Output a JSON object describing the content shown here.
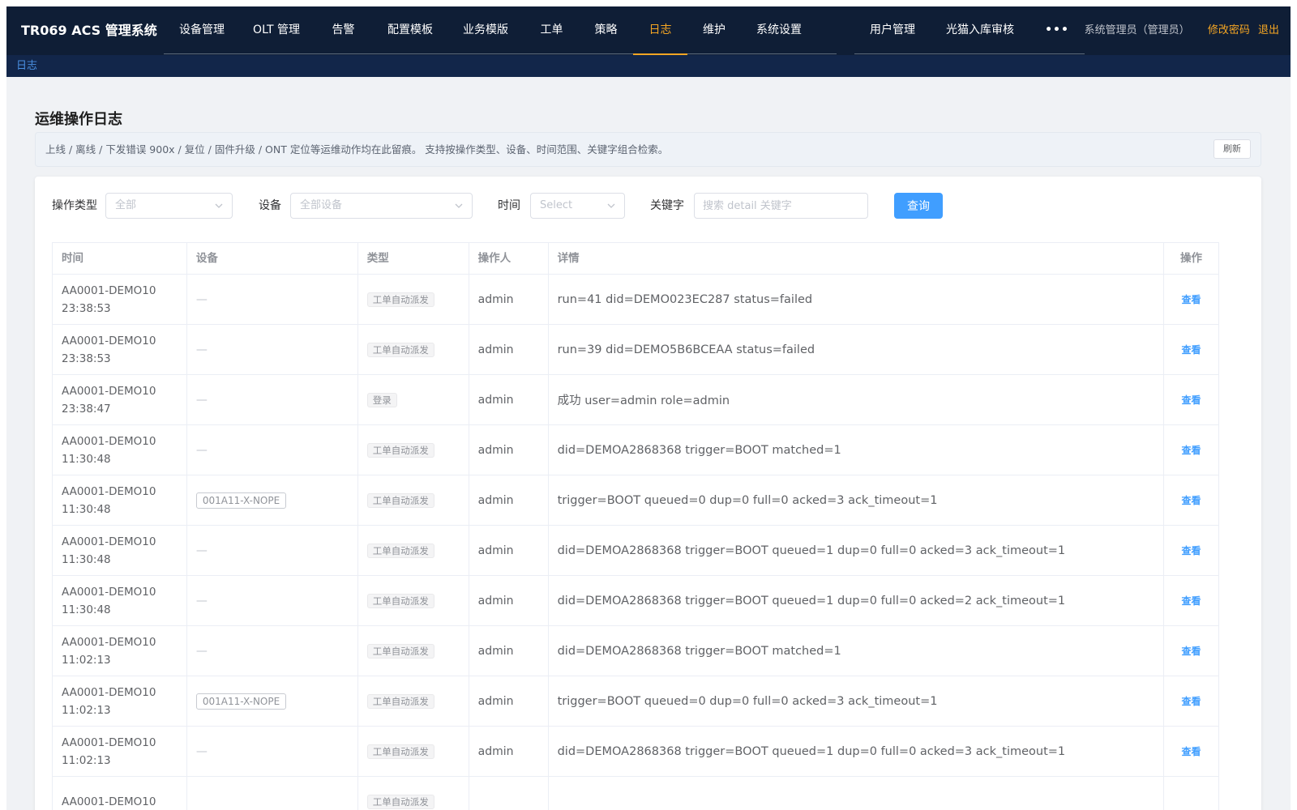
{
  "app": {
    "title": "TR069 ACS 管理系统"
  },
  "nav": {
    "group1": [
      {
        "label": "设备管理",
        "active": false,
        "w": 94
      },
      {
        "label": "OLT 管理",
        "active": false,
        "w": 90
      },
      {
        "label": "告警",
        "active": false,
        "w": 75
      },
      {
        "label": "配置模板",
        "active": false,
        "w": 90
      },
      {
        "label": "业务模版",
        "active": false,
        "w": 96
      },
      {
        "label": "工单",
        "active": false,
        "w": 67
      },
      {
        "label": "策略",
        "active": false,
        "w": 67
      },
      {
        "label": "日志",
        "active": true,
        "w": 67
      },
      {
        "label": "维护",
        "active": false,
        "w": 66
      },
      {
        "label": "系统设置",
        "active": false,
        "w": 94
      }
    ],
    "group2": [
      {
        "label": "用户管理",
        "active": false
      },
      {
        "label": "光猫入库审核",
        "active": false
      },
      {
        "label": "•••",
        "active": false
      }
    ]
  },
  "user": {
    "name": "系统管理员（管理员）",
    "change_password": "修改密码",
    "logout": "退出"
  },
  "breadcrumb": {
    "current": "日志"
  },
  "page": {
    "title": "运维操作日志",
    "description": "上线 / 离线 / 下发错误 900x / 复位 / 固件升级 / ONT 定位等运维动作均在此留痕。 支持按操作类型、设备、时间范围、关键字组合检索。",
    "refresh_label": "刷新"
  },
  "filters": {
    "type_label": "操作类型",
    "type_value": "全部",
    "device_label": "设备",
    "device_value": "全部设备",
    "time_label": "时间",
    "time_value": "Select",
    "keyword_label": "关键字",
    "keyword_placeholder": "搜索 detail 关键字",
    "query_label": "查询"
  },
  "table": {
    "columns": [
      "时间",
      "设备",
      "类型",
      "操作人",
      "详情",
      "操作"
    ],
    "rows": [
      {
        "time1": "AA0001-DEMO10",
        "time2": "23:38:53",
        "device": "",
        "type": "工单自动派发",
        "operator": "admin",
        "detail": "run=41 did=DEMO023EC287 status=failed",
        "action": "查看"
      },
      {
        "time1": "AA0001-DEMO10",
        "time2": "23:38:53",
        "device": "",
        "type": "工单自动派发",
        "operator": "admin",
        "detail": "run=39 did=DEMO5B6BCEAA status=failed",
        "action": "查看"
      },
      {
        "time1": "AA0001-DEMO10",
        "time2": "23:38:47",
        "device": "",
        "type": "登录",
        "operator": "admin",
        "detail": "成功 user=admin role=admin",
        "action": "查看"
      },
      {
        "time1": "AA0001-DEMO10",
        "time2": "11:30:48",
        "device": "",
        "type": "工单自动派发",
        "operator": "admin",
        "detail": "did=DEMOA2868368 trigger=BOOT matched=1",
        "action": "查看"
      },
      {
        "time1": "AA0001-DEMO10",
        "time2": "11:30:48",
        "device": "001A11-X-NOPE",
        "type": "工单自动派发",
        "operator": "admin",
        "detail": "trigger=BOOT queued=0 dup=0 full=0 acked=3 ack_timeout=1",
        "action": "查看"
      },
      {
        "time1": "AA0001-DEMO10",
        "time2": "11:30:48",
        "device": "",
        "type": "工单自动派发",
        "operator": "admin",
        "detail": "did=DEMOA2868368 trigger=BOOT queued=1 dup=0 full=0 acked=3 ack_timeout=1",
        "action": "查看"
      },
      {
        "time1": "AA0001-DEMO10",
        "time2": "11:30:48",
        "device": "",
        "type": "工单自动派发",
        "operator": "admin",
        "detail": "did=DEMOA2868368 trigger=BOOT queued=1 dup=0 full=0 acked=2 ack_timeout=1",
        "action": "查看"
      },
      {
        "time1": "AA0001-DEMO10",
        "time2": "11:02:13",
        "device": "",
        "type": "工单自动派发",
        "operator": "admin",
        "detail": "did=DEMOA2868368 trigger=BOOT matched=1",
        "action": "查看"
      },
      {
        "time1": "AA0001-DEMO10",
        "time2": "11:02:13",
        "device": "001A11-X-NOPE",
        "type": "工单自动派发",
        "operator": "admin",
        "detail": "trigger=BOOT queued=0 dup=0 full=0 acked=3 ack_timeout=1",
        "action": "查看"
      },
      {
        "time1": "AA0001-DEMO10",
        "time2": "11:02:13",
        "device": "",
        "type": "工单自动派发",
        "operator": "admin",
        "detail": "did=DEMOA2868368 trigger=BOOT queued=1 dup=0 full=0 acked=3 ack_timeout=1",
        "action": "查看"
      },
      {
        "time1": "AA0001-DEMO10",
        "time2": "",
        "device": "",
        "type": "工单自动派发",
        "operator": "",
        "detail": "",
        "action": ""
      }
    ]
  },
  "colors": {
    "nav_bg": "#0f1e36",
    "accent": "#f5a623",
    "primary": "#409eff"
  }
}
